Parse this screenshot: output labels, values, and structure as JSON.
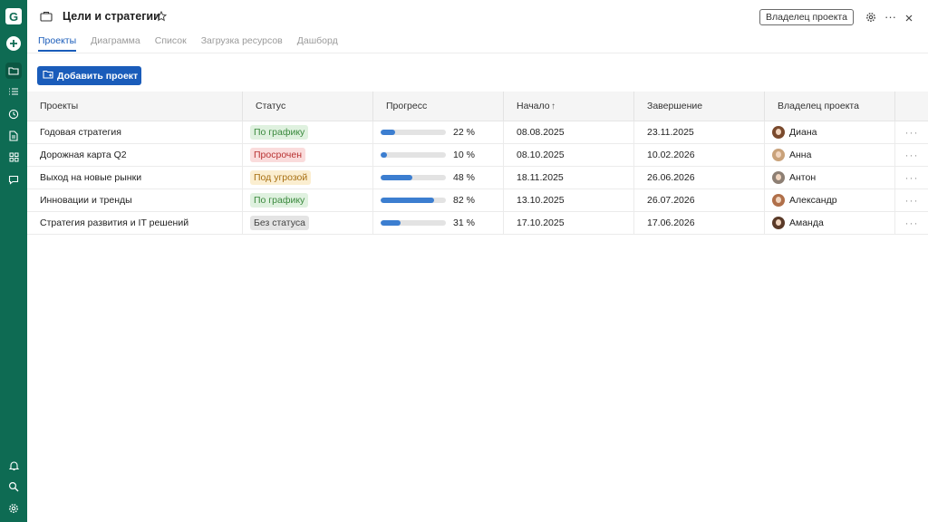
{
  "app": {
    "logo_letter": "G",
    "title": "Цели и стратегии",
    "owner_button": "Владелец проекта"
  },
  "tabs": [
    {
      "label": "Проекты",
      "active": true
    },
    {
      "label": "Диаграмма",
      "active": false
    },
    {
      "label": "Список",
      "active": false
    },
    {
      "label": "Загрузка ресурсов",
      "active": false
    },
    {
      "label": "Дашборд",
      "active": false
    }
  ],
  "toolbar": {
    "add_project_label": "Добавить проект"
  },
  "table": {
    "headers": [
      "Проекты",
      "Статус",
      "Прогресс",
      "Начало",
      "Завершение",
      "Владелец проекта"
    ],
    "sort_indicator": "↑",
    "rows": [
      {
        "project": "Годовая стратегия",
        "status": "По графику",
        "status_bg": "#dff1df",
        "status_fg": "#3b8a3e",
        "progress": 22,
        "progress_label": "22 %",
        "start": "08.08.2025",
        "end": "23.11.2025",
        "owner": "Диана",
        "avatar_color": "#7a4a2d"
      },
      {
        "project": "Дорожная карта Q2",
        "status": "Просрочен",
        "status_bg": "#fadcdc",
        "status_fg": "#b83232",
        "progress": 10,
        "progress_label": "10 %",
        "start": "08.10.2025",
        "end": "10.02.2026",
        "owner": "Анна",
        "avatar_color": "#c9a27a"
      },
      {
        "project": "Выход на новые рынки",
        "status": "Под угрозой",
        "status_bg": "#fbeed0",
        "status_fg": "#a76f12",
        "progress": 48,
        "progress_label": "48 %",
        "start": "18.11.2025",
        "end": "26.06.2026",
        "owner": "Антон",
        "avatar_color": "#8d7f74"
      },
      {
        "project": "Инновации и тренды",
        "status": "По графику",
        "status_bg": "#dff1df",
        "status_fg": "#3b8a3e",
        "progress": 82,
        "progress_label": "82 %",
        "start": "13.10.2025",
        "end": "26.07.2026",
        "owner": "Александр",
        "avatar_color": "#b0704a"
      },
      {
        "project": "Стратегия развития и  IT решений",
        "status": "Без статуса",
        "status_bg": "#e4e4e4",
        "status_fg": "#444444",
        "progress": 31,
        "progress_label": "31 %",
        "start": "17.10.2025",
        "end": "17.06.2026",
        "owner": "Аманда",
        "avatar_color": "#5a3a28"
      }
    ],
    "row_menu": "···"
  },
  "colors": {
    "rail": "#0e6b53",
    "accent": "#1a5cba",
    "progress_fill": "#3c7ed0"
  },
  "icons": [
    "logo-icon",
    "plus-icon",
    "folder-icon",
    "list-icon",
    "clock-icon",
    "document-icon",
    "grid-icon",
    "chat-icon",
    "bell-icon",
    "search-icon",
    "gear-icon",
    "star-icon",
    "more-icon",
    "close-icon",
    "folder-add-icon",
    "sort-up-icon"
  ]
}
